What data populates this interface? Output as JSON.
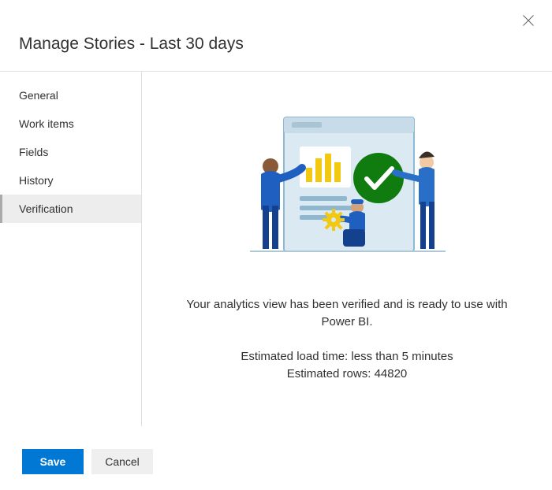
{
  "header": {
    "title": "Manage Stories - Last 30 days"
  },
  "sidebar": {
    "items": [
      {
        "label": "General",
        "selected": false
      },
      {
        "label": "Work items",
        "selected": false
      },
      {
        "label": "Fields",
        "selected": false
      },
      {
        "label": "History",
        "selected": false
      },
      {
        "label": "Verification",
        "selected": true
      }
    ]
  },
  "content": {
    "verified_message": "Your analytics view has been verified and is ready to use with Power BI.",
    "estimated_load_label": "Estimated load time:",
    "estimated_load_value": "less than 5 minutes",
    "estimated_rows_label": "Estimated rows:",
    "estimated_rows_value": "44820"
  },
  "footer": {
    "save_label": "Save",
    "cancel_label": "Cancel"
  },
  "icons": {
    "close": "close-icon",
    "checkmark": "checkmark-circle-icon"
  }
}
